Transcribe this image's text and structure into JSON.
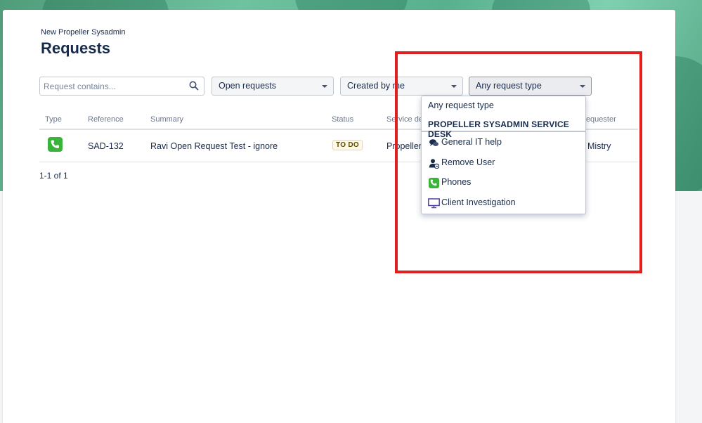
{
  "breadcrumb": "New Propeller Sysadmin",
  "title": "Requests",
  "filters": {
    "search_placeholder": "Request contains...",
    "status_select": "Open requests",
    "created_select": "Created by me",
    "type_select": "Any request type"
  },
  "table": {
    "headers": [
      "Type",
      "Reference",
      "Summary",
      "Status",
      "Service desk",
      "Requester"
    ],
    "rows": [
      {
        "type_icon": "phone-icon",
        "reference": "SAD-132",
        "summary": "Ravi Open Request Test - ignore",
        "status": "TO DO",
        "service_desk": "Propeller",
        "requester": "Mistry"
      }
    ]
  },
  "pagination": "1-1 of 1",
  "dropdown": {
    "any": "Any request type",
    "group_label": "PROPELLER SYSADMIN SERVICE DESK",
    "items": [
      {
        "label": "General IT help",
        "icon": "chat-bubbles-icon"
      },
      {
        "label": "Remove User",
        "icon": "remove-user-icon"
      },
      {
        "label": "Phones",
        "icon": "phone-icon"
      },
      {
        "label": "Client Investigation",
        "icon": "monitor-icon"
      }
    ]
  },
  "colors": {
    "highlight": "#e11f1f",
    "phone_icon": "#3ab33a",
    "monitor_icon": "#5243aa"
  }
}
